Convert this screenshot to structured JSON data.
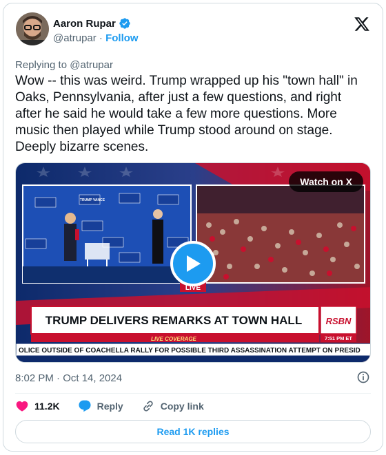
{
  "author": {
    "name": "Aaron Rupar",
    "handle": "@atrupar",
    "separator": " · ",
    "follow_label": "Follow",
    "verified": true
  },
  "header": {
    "logo_icon": "x-logo-icon"
  },
  "replying_to": "Replying to @atrupar",
  "tweet_text": "Wow -- this was weird. Trump wrapped up his \"town hall\" in Oaks, Pennsylvania, after just a few questions, and right after he said he would take a few more questions. More music then played while Trump stood around on stage. Deeply bizarre scenes.",
  "media": {
    "watch_label": "Watch on X",
    "live_tag": "LIVE",
    "headline": "TRUMP DELIVERS REMARKS AT TOWN HALL",
    "coverage_label": "LIVE COVERAGE",
    "ticker": "OLICE OUTSIDE OF COACHELLA RALLY FOR POSSIBLE THIRD ASSASSINATION ATTEMPT ON PRESID",
    "network_logo": "RSBN",
    "network_time": "7:51 PM ET",
    "backdrop_sign": "TRUMP VANCE",
    "colors": {
      "banner_red": "#c8102e",
      "banner_navy": "#0d2a6b",
      "stage_blue": "#1d4fb5"
    }
  },
  "timestamp": "8:02 PM · Oct 14, 2024",
  "actions": {
    "likes": "11.2K",
    "reply_label": "Reply",
    "copy_link_label": "Copy link"
  },
  "read_replies_label": "Read 1K replies",
  "colors": {
    "accent": "#1d9bf0",
    "like_red": "#f91880",
    "text_secondary": "#536471"
  }
}
